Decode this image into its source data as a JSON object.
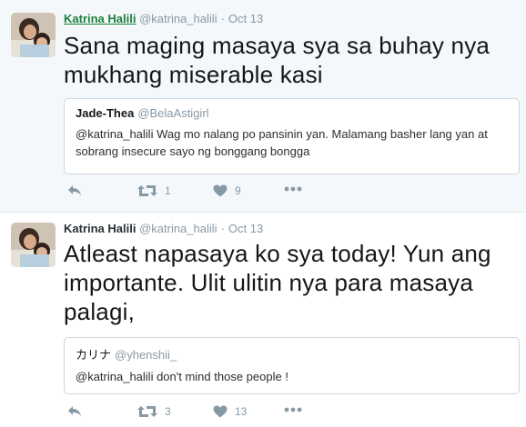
{
  "tweets": [
    {
      "name": "Katrina Halili",
      "handle": "@katrina_halili",
      "date": "Oct 13",
      "text": "Sana maging masaya sya sa buhay nya mukhang miserable kasi",
      "quote": {
        "name": "Jade-Thea",
        "handle": "@BelaAstigirl",
        "text": "@katrina_halili  Wag mo nalang po pansinin yan. Malamang basher lang yan at sobrang insecure sayo ng bonggang bongga"
      },
      "retweets": "1",
      "likes": "9"
    },
    {
      "name": "Katrina Halili",
      "handle": "@katrina_halili",
      "date": "Oct 13",
      "text": "Atleast napasaya ko sya today! Yun ang importante. Ulit ulitin nya para masaya palagi,",
      "quote": {
        "name": "カリナ",
        "handle": "@yhenshii_",
        "text": "@katrina_halili don't mind those people !"
      },
      "retweets": "3",
      "likes": "13"
    }
  ],
  "icons": {
    "reply": "reply-icon",
    "retweet": "retweet-icon",
    "like": "heart-icon",
    "more": "more-icon"
  },
  "colors": {
    "name_hover": "#1b7f3b",
    "muted": "#8899a6",
    "border": "#ccd6dd",
    "tweet_bg_highlight": "#f5f8fa"
  }
}
